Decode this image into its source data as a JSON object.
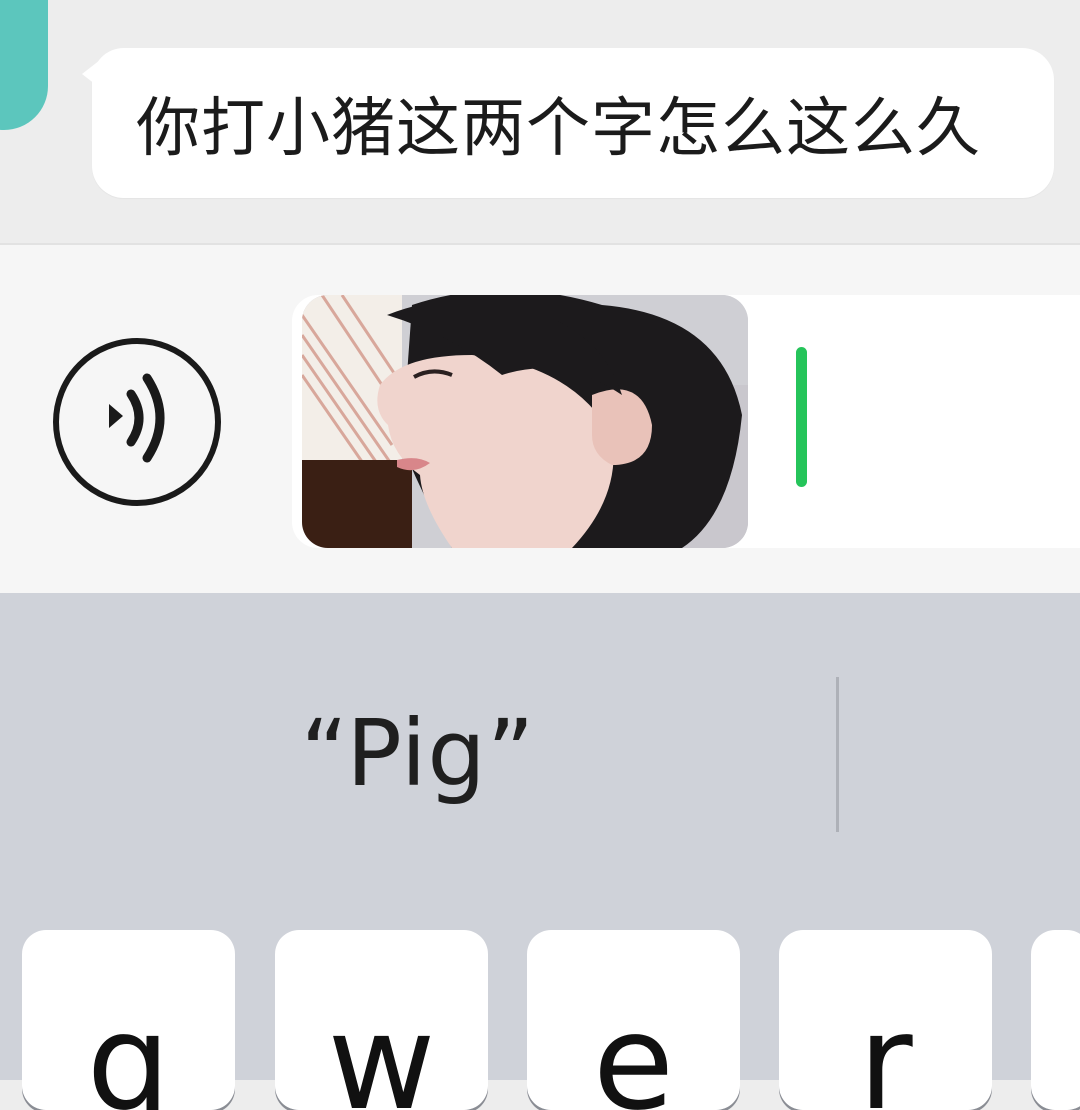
{
  "chat": {
    "message_text": "你打小猪这两个字怎么这么久"
  },
  "input_bar": {
    "voice_icon": "voice-icon",
    "sticker_icon": "sticker-image",
    "cursor_color": "#25c45a"
  },
  "keyboard": {
    "suggestion": "“Pig”",
    "keys": [
      "q",
      "w",
      "e",
      "r"
    ]
  },
  "colors": {
    "chat_background": "#ededed",
    "bubble": "#ffffff",
    "avatar": "#5cc6bd",
    "keyboard_background": "#cfd2d9"
  }
}
